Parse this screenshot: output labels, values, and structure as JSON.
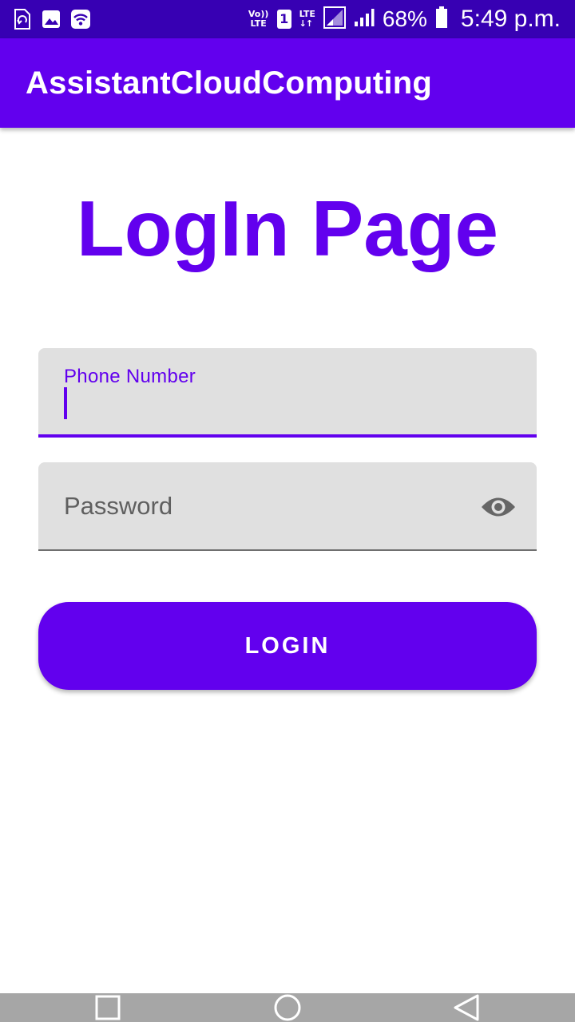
{
  "status_bar": {
    "left_icons": [
      "sync-icon",
      "gallery-icon",
      "wifi-icon"
    ],
    "volte_label_top": "Vo))",
    "volte_label_bottom": "LTE",
    "sim_slot": "1",
    "network_label": "LTE",
    "battery": "68%",
    "time": "5:49 p.m."
  },
  "app_bar": {
    "title": "AssistantCloudComputing"
  },
  "page": {
    "heading": "LogIn Page"
  },
  "form": {
    "phone": {
      "label": "Phone Number",
      "value": ""
    },
    "password": {
      "placeholder": "Password",
      "toggle_icon": "eye-icon"
    },
    "login_button": "LOGIN"
  },
  "navigation_bar": {
    "buttons": [
      "recent-apps-icon",
      "home-icon",
      "back-icon"
    ]
  },
  "colors": {
    "primary": "#6200ee",
    "primary_dark": "#3700b3",
    "field_background": "#e0e0e0",
    "nav_bar": "#a6a6a6"
  }
}
